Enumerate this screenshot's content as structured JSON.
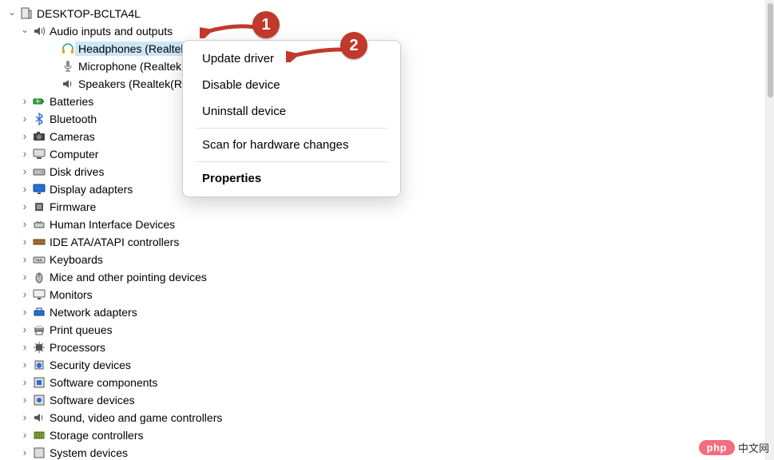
{
  "root": {
    "label": "DESKTOP-BCLTA4L"
  },
  "audio": {
    "label": "Audio inputs and outputs",
    "children": {
      "headphones": "Headphones (Realtek(R) Audio)",
      "microphone": "Microphone (Realtek(R) Audio)",
      "speakers": "Speakers (Realtek(R) Audio)"
    }
  },
  "categories": [
    "Batteries",
    "Bluetooth",
    "Cameras",
    "Computer",
    "Disk drives",
    "Display adapters",
    "Firmware",
    "Human Interface Devices",
    "IDE ATA/ATAPI controllers",
    "Keyboards",
    "Mice and other pointing devices",
    "Monitors",
    "Network adapters",
    "Print queues",
    "Processors",
    "Security devices",
    "Software components",
    "Software devices",
    "Sound, video and game controllers",
    "Storage controllers",
    "System devices"
  ],
  "context_menu": {
    "update": "Update driver",
    "disable": "Disable device",
    "uninstall": "Uninstall device",
    "scan": "Scan for hardware changes",
    "properties": "Properties"
  },
  "annotations": {
    "b1": "1",
    "b2": "2"
  },
  "watermark": {
    "pill": "php",
    "text": "中文网"
  }
}
